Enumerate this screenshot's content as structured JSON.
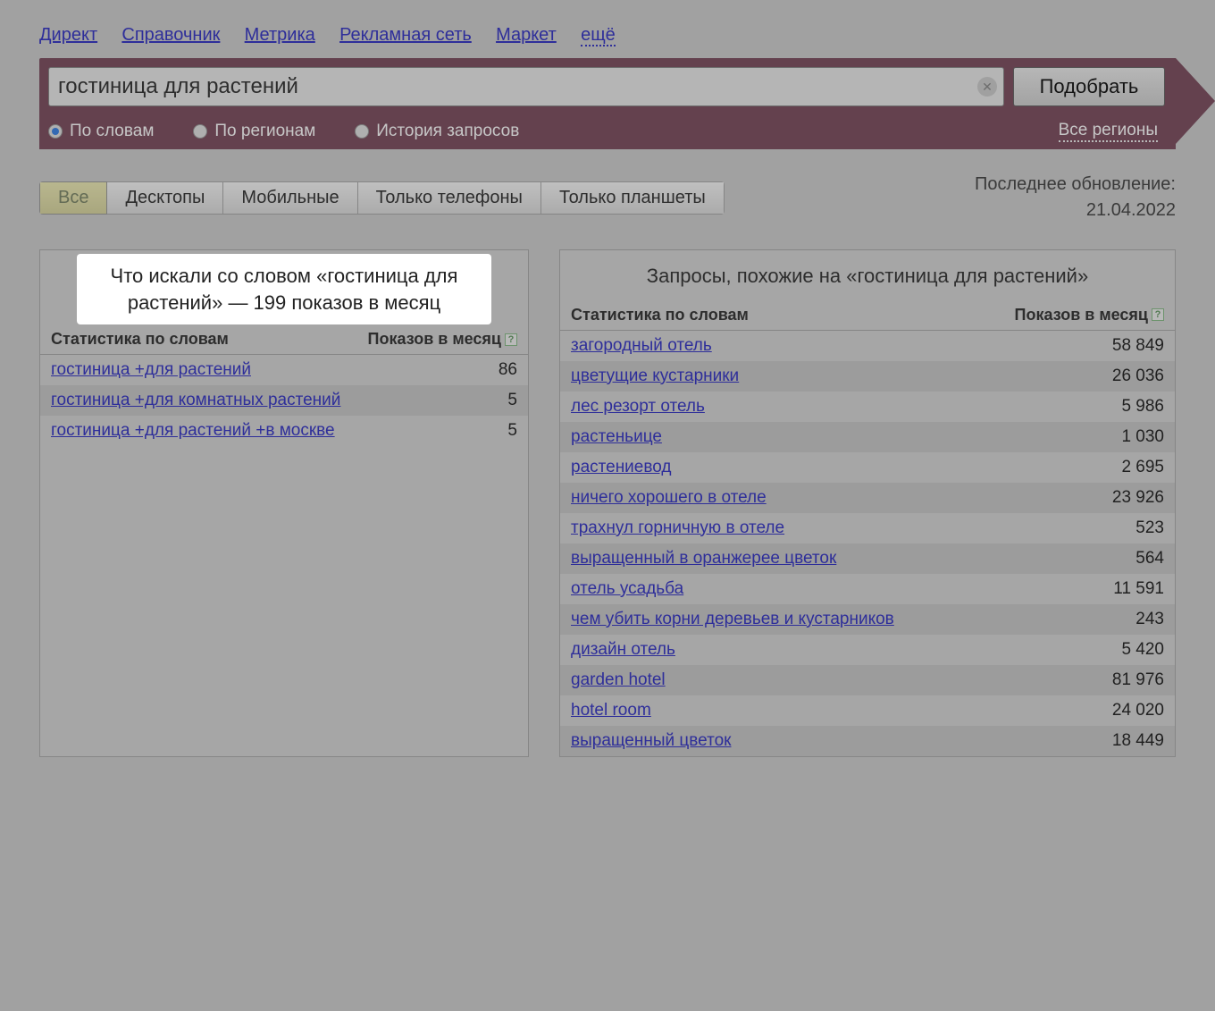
{
  "toplinks": {
    "items": [
      "Директ",
      "Справочник",
      "Метрика",
      "Рекламная сеть",
      "Маркет"
    ],
    "more": "ещё"
  },
  "search": {
    "value": "гостиница для растений",
    "submit": "Подобрать",
    "radios": {
      "words": "По словам",
      "regions": "По регионам",
      "history": "История запросов"
    },
    "all_regions": "Все регионы"
  },
  "device_tabs": {
    "all": "Все",
    "desktops": "Десктопы",
    "mobile": "Мобильные",
    "phones": "Только телефоны",
    "tablets": "Только планшеты"
  },
  "last_update": {
    "label": "Последнее обновление:",
    "date": "21.04.2022"
  },
  "columns": {
    "stat": "Статистика по словам",
    "count": "Показов в месяц",
    "help": "?"
  },
  "left_panel": {
    "title": "Что искали со словом «гостиница для растений» — 199 показов в месяц",
    "rows": [
      {
        "q": "гостиница +для растений",
        "c": "86"
      },
      {
        "q": "гостиница +для комнатных растений",
        "c": "5"
      },
      {
        "q": "гостиница +для растений +в москве",
        "c": "5"
      }
    ]
  },
  "right_panel": {
    "title": "Запросы, похожие на «гостиница для растений»",
    "rows": [
      {
        "q": "загородный отель",
        "c": "58 849"
      },
      {
        "q": "цветущие кустарники",
        "c": "26 036"
      },
      {
        "q": "лес резорт отель",
        "c": "5 986"
      },
      {
        "q": "растеньице",
        "c": "1 030"
      },
      {
        "q": "растениевод",
        "c": "2 695"
      },
      {
        "q": "ничего хорошего в отеле",
        "c": "23 926"
      },
      {
        "q": "трахнул горничную в отеле",
        "c": "523"
      },
      {
        "q": "выращенный в оранжерее цветок",
        "c": "564"
      },
      {
        "q": "отель усадьба",
        "c": "11 591"
      },
      {
        "q": "чем убить корни деревьев и кустарников",
        "c": "243"
      },
      {
        "q": "дизайн отель",
        "c": "5 420"
      },
      {
        "q": "garden hotel",
        "c": "81 976"
      },
      {
        "q": "hotel room",
        "c": "24 020"
      },
      {
        "q": "выращенный цветок",
        "c": "18 449"
      }
    ]
  }
}
